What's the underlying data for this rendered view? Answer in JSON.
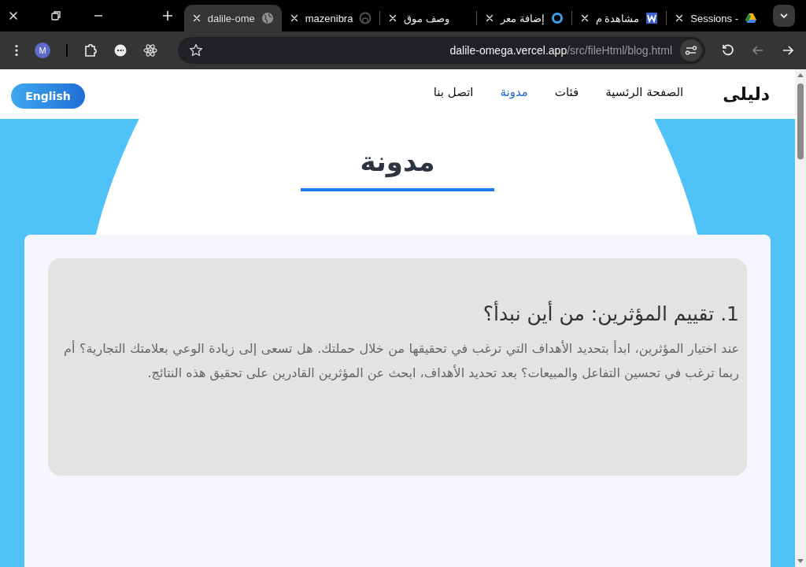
{
  "browser": {
    "tabs": [
      {
        "title": "Sessions -",
        "selected": false
      },
      {
        "title": "مشاهدة م",
        "selected": false
      },
      {
        "title": "إضافة معر",
        "selected": false
      },
      {
        "title": "وصف موق",
        "selected": false
      },
      {
        "title": "mazenibra",
        "selected": false
      },
      {
        "title": "dalile-ome",
        "selected": true
      }
    ],
    "avatar": "M",
    "url": {
      "host": "dalile-omega.vercel.app",
      "path": "/src/fileHtml/blog.html"
    }
  },
  "nav": {
    "logo": "دليلى",
    "links": [
      {
        "label": "الصفحة الرئسية",
        "selected": false
      },
      {
        "label": "فئات",
        "selected": false
      },
      {
        "label": "مدونة",
        "selected": true
      },
      {
        "label": "اتصل بنا",
        "selected": false
      }
    ],
    "language_button": "English"
  },
  "page_title": "مدونة",
  "posts": [
    {
      "heading": "1. تقييم المؤثرين: من أين نبدأ؟",
      "body": "عند اختيار المؤثرين، ابدأ بتحديد الأهداف التي ترغب في تحقيقها من خلال حملتك. هل تسعى إلى زيادة الوعي بعلامتك التجارية؟ أم ربما ترغب في تحسين التفاعل والمبيعات؟ بعد تحديد الأهداف، ابحث عن المؤثرين القادرين على تحقيق هذه النتائج."
    }
  ]
}
